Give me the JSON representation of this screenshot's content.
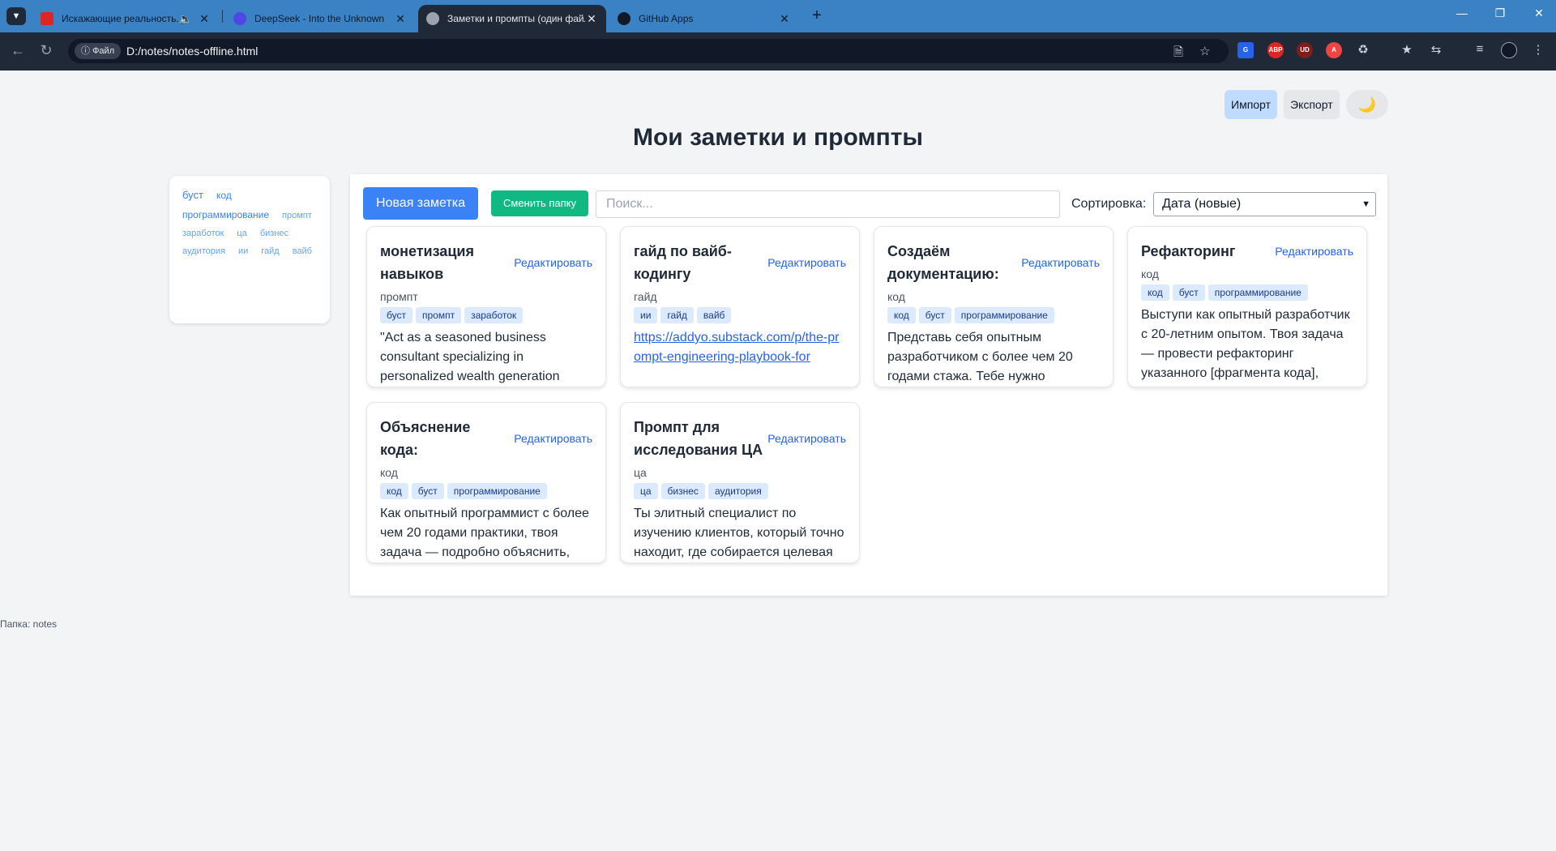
{
  "browser": {
    "tabs": [
      {
        "title": "Искажающие реальность. Кн"
      },
      {
        "title": "DeepSeek - Into the Unknown"
      },
      {
        "title": "Заметки и промпты (один файл)"
      },
      {
        "title": "GitHub Apps"
      }
    ],
    "site_chip": "Файл",
    "url": "D:/notes/notes-offline.html",
    "extensions": [
      "ABP",
      "UD"
    ]
  },
  "header": {
    "import_label": "Импорт",
    "export_label": "Экспорт",
    "theme_icon": "🌙",
    "title": "Мои заметки и промпты"
  },
  "sidebar": {
    "tags": [
      {
        "label": "буст",
        "size": "l"
      },
      {
        "label": "код",
        "size": "m"
      },
      {
        "label": "программирование",
        "size": "m"
      },
      {
        "label": "промпт",
        "size": "s"
      },
      {
        "label": "заработок",
        "size": "s"
      },
      {
        "label": "ца",
        "size": "s"
      },
      {
        "label": "бизнес",
        "size": "s"
      },
      {
        "label": "аудитория",
        "size": "s"
      },
      {
        "label": "ии",
        "size": "s"
      },
      {
        "label": "гайд",
        "size": "s"
      },
      {
        "label": "вайб",
        "size": "s"
      }
    ]
  },
  "toolbar": {
    "new_note": "Новая заметка",
    "change_folder": "Сменить папку",
    "search_placeholder": "Поиск...",
    "sort_label": "Сортировка:",
    "sort_value": "Дата (новые)"
  },
  "edit_label": "Редактировать",
  "cards": [
    {
      "title": "монетизация навыков",
      "category": "промпт",
      "tags": [
        "буст",
        "промпт",
        "заработок"
      ],
      "text": "\"Act as a seasoned business consultant specializing in personalized wealth generation",
      "is_link": false
    },
    {
      "title": "гайд по вайб-кодингу",
      "category": "гайд",
      "tags": [
        "ии",
        "гайд",
        "вайб"
      ],
      "text": "https://addyo.substack.com/p/the-prompt-engineering-playbook-for",
      "is_link": true
    },
    {
      "title": "Создаём документацию:",
      "category": "код",
      "tags": [
        "код",
        "буст",
        "программирование"
      ],
      "text": "Представь себя опытным разработчиком с более чем 20 годами стажа. Тебе нужно",
      "is_link": false
    },
    {
      "title": "Рефакторинг",
      "category": "код",
      "tags": [
        "код",
        "буст",
        "программирование"
      ],
      "text": "Выступи как опытный разработчик с 20-летним опытом. Твоя задача — провести рефакторинг указанного [фрагмента кода],",
      "is_link": false
    },
    {
      "title": "Объяснение кода:",
      "category": "код",
      "tags": [
        "код",
        "буст",
        "программирование"
      ],
      "text": "Как опытный программист с более чем 20 годами практики, твоя задача — подробно объяснить, что делает конкретный [фрагмент",
      "is_link": false
    },
    {
      "title": "Промпт для исследования ЦА",
      "category": "ца",
      "tags": [
        "ца",
        "бизнес",
        "аудитория"
      ],
      "text": "Ты элитный специалист по изучению клиентов, который точно находит, где собирается целевая",
      "is_link": false
    }
  ],
  "footer": {
    "folder": "Папка: notes"
  }
}
